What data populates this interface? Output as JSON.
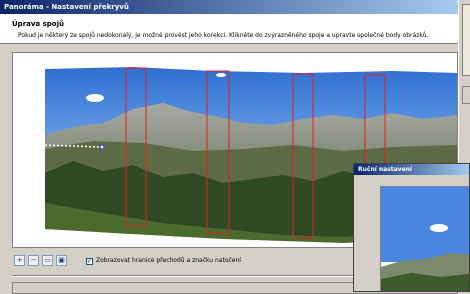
{
  "window": {
    "title": "Panoráma - Nastavení překryvů"
  },
  "header": {
    "title": "Úprava spojů",
    "instructions": "Pokud je některý ze spojů nedokonalý, je možné provést jeho korekci. Klikněte do zvýrazněného spoje a upravte společné body obrázků."
  },
  "toolbar": {
    "zoom_in_icon": "zoom-in-icon",
    "zoom_out_icon": "zoom-out-icon",
    "zoom_fit_icon": "zoom-fit-icon",
    "zoom_full_icon": "zoom-full-icon",
    "show_borders_checked": true,
    "show_borders_label": "Zobrazovat hranice přechodů a značku natočení"
  },
  "popup": {
    "title": "Ruční nastavení"
  },
  "colors": {
    "seam_marker": "#e02020",
    "rotation_marker": "#1a3cc8",
    "sky": "#3f7bd8",
    "title_gradient_start": "#0a246a",
    "title_gradient_end": "#a6caf0"
  }
}
